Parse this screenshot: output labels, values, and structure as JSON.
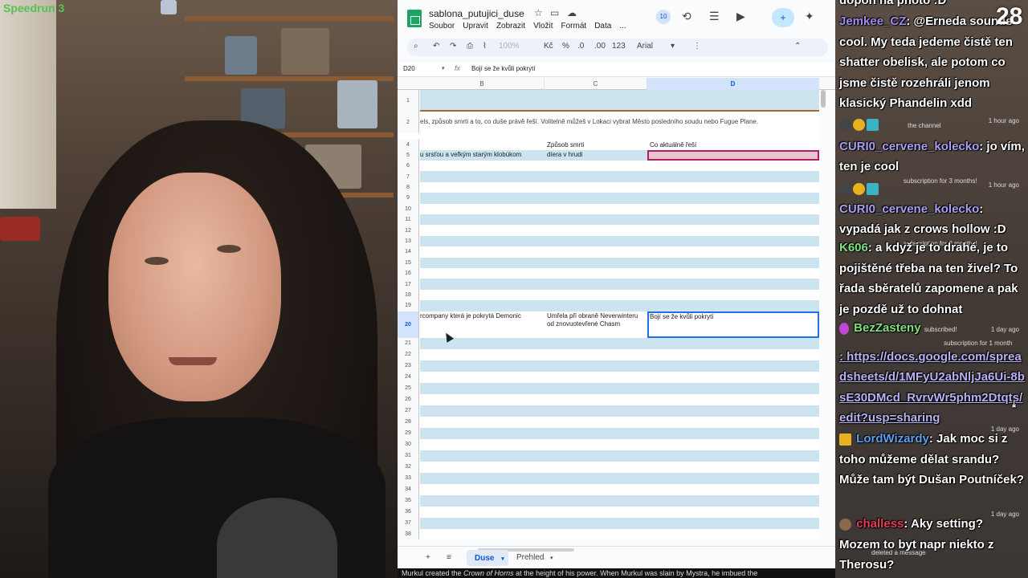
{
  "webcam": {
    "overlay_tag": "Speedrun 3"
  },
  "spreadsheet": {
    "doc_title": "sablona_putujici_duse",
    "menu": [
      "Soubor",
      "Upravit",
      "Zobrazit",
      "Vložit",
      "Formát",
      "Data",
      "..."
    ],
    "collaborator_count": "10",
    "toolbar": {
      "zoom": "100%",
      "currency": "Kč",
      "percent": "%",
      "dec_decrease": ".0",
      "dec_increase": ".00",
      "number_format": "123",
      "font": "Arial"
    },
    "name_box": "D20",
    "fx_label": "fx",
    "formula_text": "Bojí se že kvůli pokrytí",
    "columns": [
      "B",
      "C",
      "D"
    ],
    "rows": {
      "r2_text": "els, způsob smrti a to, co duše právě řeší. Volitelně můžeš v Lokaci vybrat Město posledního soudu nebo Fugue Plane.",
      "r4_c": "Způsob smrti",
      "r4_d": "Co aktuálně řeší",
      "r5_b": "u srsťou a veľkým starým klobúkom",
      "r5_c": "díera v hrudi",
      "r20_b": "rcompany která je pokrytá Demonic",
      "r20_c": "Umřela při obraně Neverwinteru od znovuotevřené Chasm",
      "r20_d": "Bojí se že kvůli pokrytí"
    },
    "row_numbers": [
      "1",
      "2",
      "4",
      "5",
      "6",
      "7",
      "8",
      "9",
      "10",
      "11",
      "12",
      "13",
      "14",
      "15",
      "16",
      "17",
      "18",
      "19",
      "20",
      "21",
      "22",
      "23",
      "24",
      "25",
      "26",
      "27",
      "28",
      "29",
      "30",
      "31",
      "32",
      "33",
      "34",
      "35",
      "36",
      "37",
      "38"
    ],
    "tabs": {
      "add": "+",
      "all_sheets": "≡",
      "active": "Duse",
      "other": "Prehled"
    }
  },
  "caption": {
    "prefix": "Murkul created the ",
    "title": "Crown of Horns",
    "suffix": " at the height of his power. When Murkul was slain by Mystra, he imbued the"
  },
  "chat": {
    "counter": "28",
    "messages": [
      {
        "user": "",
        "text": "dopoň na photo :D",
        "color": "#ffffff",
        "ts": ""
      },
      {
        "user": "Jemkee_CZ",
        "text": ": @Erneda sounds cool. My teda jedeme čistě ten shatter obelisk, ale potom co jsme čistě rozehráli jenom klasický Phandelin xdd",
        "color": "#9e8cf0",
        "ts": ""
      },
      {
        "user": "CURI0_cervene_kolecko",
        "text": ": jo vím, ten je cool",
        "color": "#a9a0f5",
        "ts": "1 hour ago"
      },
      {
        "user": "CURI0_cervene_kolecko",
        "text": ": vypadá jak z crows hollow :D",
        "color": "#a9a0f5",
        "ts": "1 hour ago"
      },
      {
        "user": "K606",
        "text": ": a když je to drahé, je to pojištěné třeba na ten živel? To řada sběratelů zapomene a pak je pozdě už to dohnat",
        "color": "#7fe07f",
        "ts": ""
      },
      {
        "user": "BezZasteny",
        "text": ": https://docs.google.com/spreadsheets/d/1MFyU2abNljJa6Ui-8bsE30DMcd_RvrvWr5phm2Dtqts/edit?usp=sharing",
        "color": "#7fe07f",
        "ts": "1 day ago"
      },
      {
        "user": "LordWizardy",
        "text": ": Jak moc si z toho můžeme dělat srandu? Může tam být Dušan Poutníček?",
        "color": "#5ba0f2",
        "ts": "1 day ago"
      },
      {
        "user": "challess",
        "text": ": Aky setting? Mozem to byt napr niekto z Therosu?",
        "color": "#e83a55",
        "ts": "1 day ago"
      }
    ],
    "sub_notes": [
      "the channel",
      "subscription for 3 months!",
      "subscription for 2 months!",
      "subscribed!",
      "subscription for 1 month",
      "deleted a message"
    ]
  }
}
